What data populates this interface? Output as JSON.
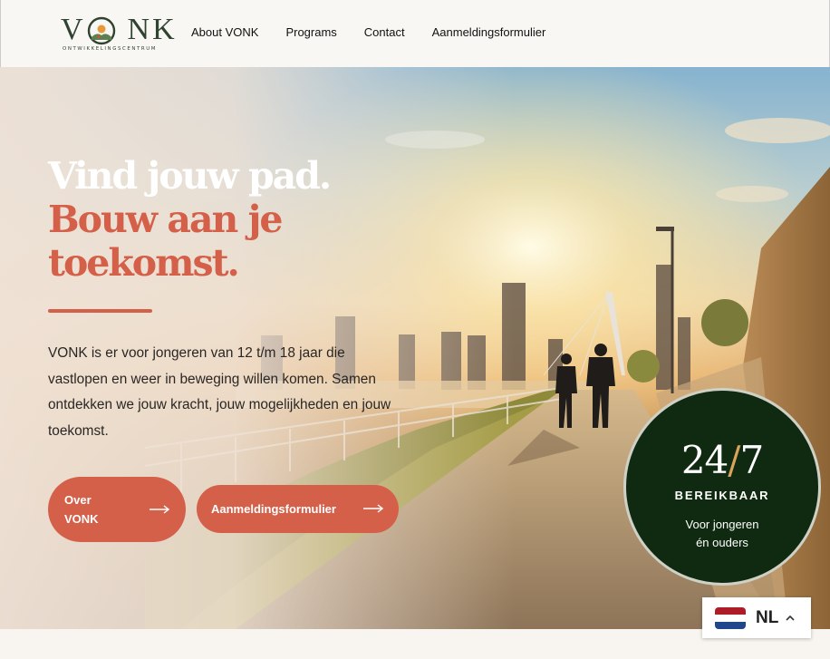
{
  "header": {
    "logo_word": "VONK",
    "logo_subtitle": "ONTWIKKELINGSCENTRUM",
    "nav": [
      {
        "label": "About VONK"
      },
      {
        "label": "Programs"
      },
      {
        "label": "Contact"
      },
      {
        "label": "Aanmeldingsformulier"
      }
    ]
  },
  "hero": {
    "title_line1": "Vind jouw pad.",
    "title_line2a": "Bouw aan je",
    "title_line2b": "toekomst.",
    "intro": "VONK is er voor jongeren van 12 t/m 18 jaar die vastlopen en weer in beweging willen komen. Samen ontdekken we jouw kracht, jouw mogelijkheden en jouw toekomst.",
    "btn_about_line1": "Over",
    "btn_about_line2": "VONK",
    "btn_form": "Aanmeldingsformulier",
    "arrow_icon": "arrow-right-icon"
  },
  "badge": {
    "hours_a": "24",
    "slash": "/",
    "hours_b": "7",
    "label": "BEREIKBAAR",
    "sub1": "Voor jongeren",
    "sub2": "én ouders"
  },
  "language": {
    "code": "NL",
    "flag_icon": "netherlands-flag-icon",
    "chevron_icon": "chevron-up-icon"
  },
  "colors": {
    "accent": "#d4604a",
    "badge_bg": "#0f2a10",
    "badge_slash": "#d9a35c",
    "logo": "#2e4330"
  }
}
